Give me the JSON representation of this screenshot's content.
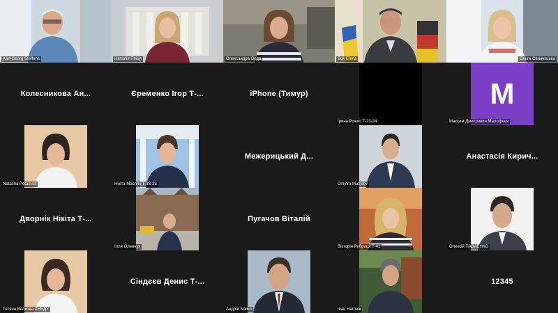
{
  "participants": [
    {
      "name": "Karl-Georg Steffens",
      "type": "video"
    },
    {
      "name": "Наталія Ппіця",
      "type": "video"
    },
    {
      "name": "Олександра Орда",
      "type": "video"
    },
    {
      "name": "Suk Elena",
      "type": "video"
    },
    {
      "name": "Ольга Свинчиська",
      "type": "video"
    },
    {
      "name": "Колесникова Ан...",
      "type": "text"
    },
    {
      "name": "Єременко Ігор Т-...",
      "type": "text"
    },
    {
      "name": "iPhone (Тимур)",
      "type": "text"
    },
    {
      "name": "Ірина Рожко Т-23-24",
      "type": "video"
    },
    {
      "name": "Максим Дмитрович Малофеєв",
      "type": "avatar",
      "initial": "M",
      "avatar_color": "#7b3fc6"
    },
    {
      "name": "Natasha Potamsn",
      "type": "video"
    },
    {
      "name": "Нікіта Масляк Т-33-23",
      "type": "video"
    },
    {
      "name": "Межерицький Д...",
      "type": "text"
    },
    {
      "name": "Dmytro Muzylov",
      "type": "video"
    },
    {
      "name": "Анастасія Кирич...",
      "type": "text"
    },
    {
      "name": "Дворнік Нікіта Т-...",
      "type": "text"
    },
    {
      "name": "Ілля Оленчук",
      "type": "video"
    },
    {
      "name": "Пугачов Віталій",
      "type": "text"
    },
    {
      "name": "Вікторія Ребриця Т-41",
      "type": "video"
    },
    {
      "name": "Олексій ПАВЛЕНКО",
      "type": "video"
    },
    {
      "name": "Тетяна Волкова ХНЕДУ",
      "type": "video"
    },
    {
      "name": "Сіндєєв Денис Т-...",
      "type": "text"
    },
    {
      "name": "Андрій Бойко",
      "type": "video"
    },
    {
      "name": "Іван Наглюк",
      "type": "video"
    },
    {
      "name": "12345",
      "type": "text"
    }
  ]
}
